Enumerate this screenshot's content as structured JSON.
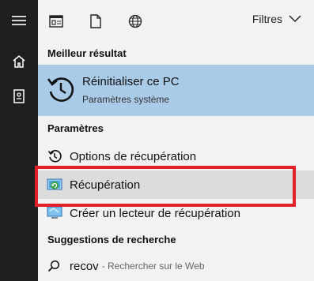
{
  "rail": {
    "items": [
      {
        "icon": "hamburger-menu-icon"
      },
      {
        "icon": "home-icon"
      },
      {
        "icon": "notebook-icon"
      }
    ]
  },
  "topbar": {
    "scope_icons": [
      "apps-scope-icon",
      "documents-scope-icon",
      "web-scope-icon"
    ],
    "filters_label": "Filtres"
  },
  "sections": {
    "best_match": "Meilleur résultat",
    "settings": "Paramètres",
    "suggestions": "Suggestions de recherche"
  },
  "best_match": {
    "title": "Réinitialiser ce PC",
    "subtitle": "Paramètres système",
    "icon": "reset-pc-icon"
  },
  "settings_items": [
    {
      "label": "Options de récupération",
      "icon": "history-icon"
    },
    {
      "label": "Récupération",
      "icon": "recovery-control-panel-icon"
    },
    {
      "label": "Créer un lecteur de récupération",
      "icon": "recovery-drive-icon"
    }
  ],
  "suggestion": {
    "query": "recov",
    "hint": "- Rechercher sur le Web",
    "icon": "search-icon"
  },
  "colors": {
    "rail": "#1f1f1f",
    "panel": "#f2f2f2",
    "best_match_bg": "#aacbe8",
    "selected_bg": "#dcdcdc",
    "annotation_box": "#e3202a"
  }
}
